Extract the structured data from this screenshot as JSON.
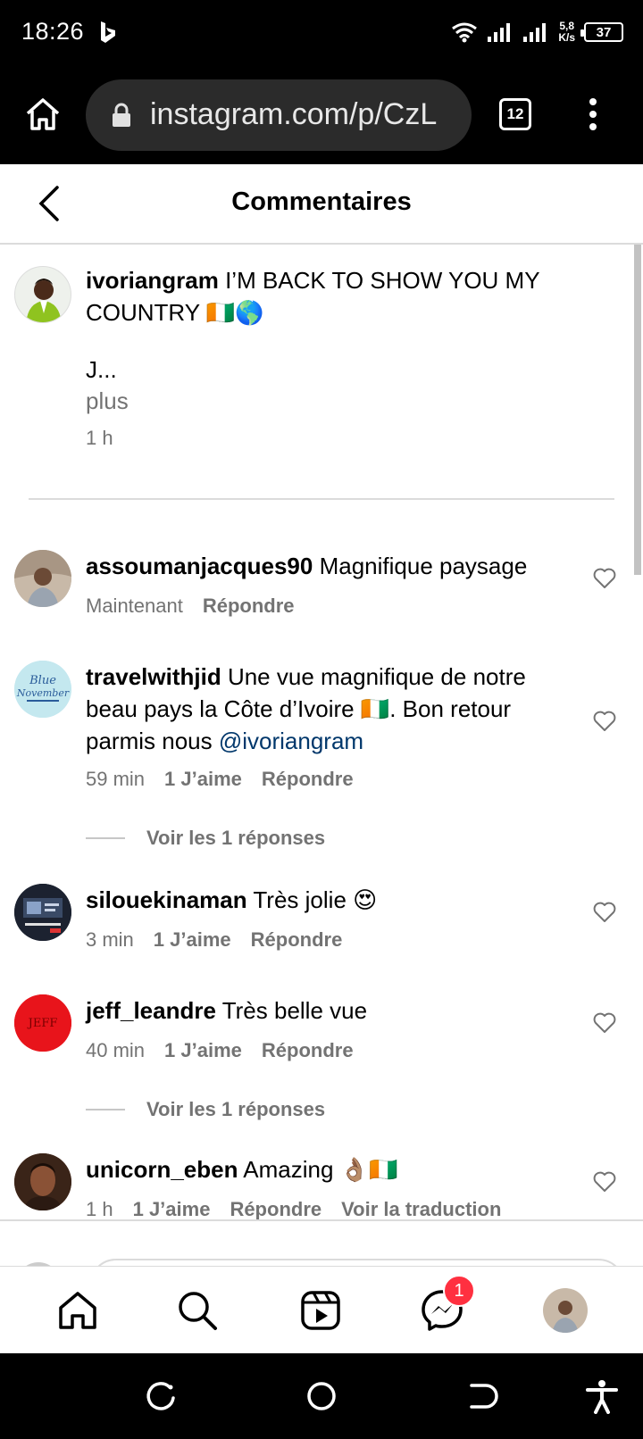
{
  "status_bar": {
    "time": "18:26",
    "speed_value": "5,8",
    "speed_unit": "K/s",
    "battery": "37"
  },
  "browser": {
    "url": "instagram.com/p/CzL",
    "tab_count": "12"
  },
  "header": {
    "title": "Commentaires"
  },
  "caption": {
    "user": "ivoriangram",
    "text": "I’M BACK TO SHOW YOU MY COUNTRY 🇨🇮🌎",
    "text_cont": "J...",
    "more": "plus",
    "time": "1 h"
  },
  "comments": [
    {
      "user": "assoumanjacques90",
      "text": "Magnifique paysage",
      "time": "Maintenant",
      "likes": "",
      "reply": "Répondre"
    },
    {
      "user": "travelwithjid",
      "text": "Une vue magnifique de notre beau pays la Côte d’Ivoire 🇨🇮. Bon retour parmis nous ",
      "mention": "@ivoriangram",
      "time": "59 min",
      "likes": "1 J’aime",
      "reply": "Répondre",
      "replies": "Voir les 1 réponses"
    },
    {
      "user": "silouekinaman",
      "text": "Très jolie 😍",
      "time": "3 min",
      "likes": "1 J’aime",
      "reply": "Répondre"
    },
    {
      "user": "jeff_leandre",
      "text": "Très belle vue",
      "time": "40 min",
      "likes": "1 J’aime",
      "reply": "Répondre",
      "replies": "Voir les 1 réponses",
      "avatar_text": "JEFF"
    },
    {
      "user": "unicorn_eben",
      "text": "Amazing 👌🏽🇨🇮",
      "time": "1 h",
      "likes": "1 J’aime",
      "reply": "Répondre",
      "translate": "Voir la traduction"
    }
  ],
  "avatar_texts": {
    "travelwithjid": [
      "Blue",
      "November"
    ]
  },
  "bottom_nav": {
    "messages_badge": "1"
  },
  "colors": {
    "badge": "#ff3040",
    "mention": "#00376b",
    "meta": "#737373"
  }
}
